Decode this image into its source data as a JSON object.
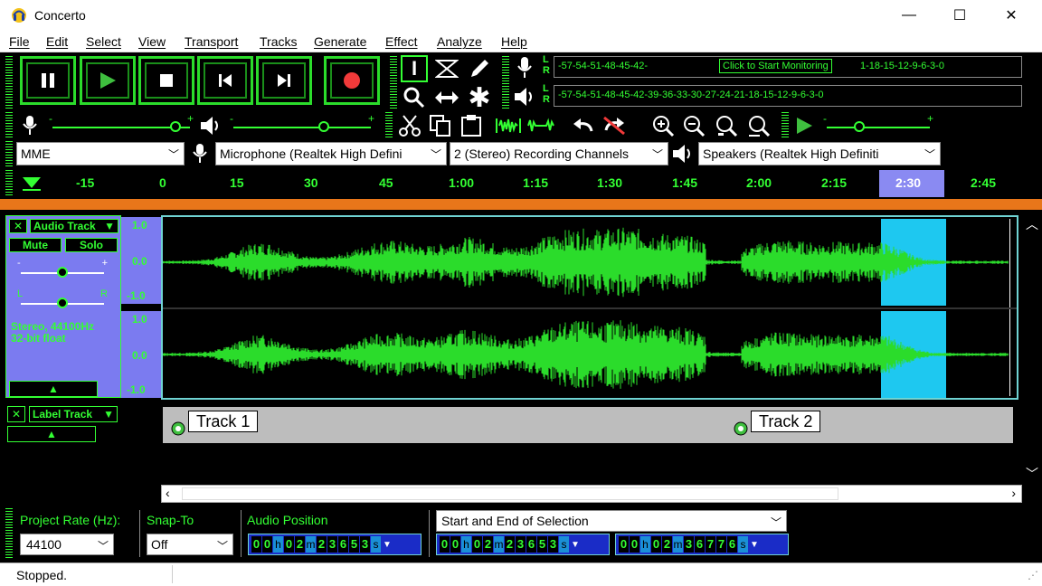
{
  "window": {
    "title": "Concerto",
    "minimize": "—",
    "maximize": "☐",
    "close": "✕"
  },
  "menu": [
    "File",
    "Edit",
    "Select",
    "View",
    "Transport",
    "Tracks",
    "Generate",
    "Effect",
    "Analyze",
    "Help"
  ],
  "meters": {
    "record_scale": "-57-54-51-48-45-42-",
    "monitor_prompt": "Click to Start Monitoring",
    "record_scale_right": "1-18-15-12-9-6-3-0",
    "play_scale": "-57-54-51-48-45-42-39-36-33-30-27-24-21-18-15-12-9-6-3-0",
    "channel_l": "L",
    "channel_r": "R"
  },
  "mixer": {
    "minus": "-",
    "plus": "+"
  },
  "device": {
    "host": "MME",
    "input": "Microphone (Realtek High Defini",
    "channels": "2 (Stereo) Recording Channels",
    "output": "Speakers (Realtek High Definiti"
  },
  "timeline": {
    "ticks": [
      "-15",
      "0",
      "15",
      "30",
      "45",
      "1:00",
      "1:15",
      "1:30",
      "1:45",
      "2:00",
      "2:15",
      "2:30",
      "2:45"
    ]
  },
  "audio_track": {
    "name": "Audio Track",
    "mute": "Mute",
    "solo": "Solo",
    "info_line1": "Stereo, 44100Hz",
    "info_line2": "32-bit float",
    "pan_l": "L",
    "pan_r": "R",
    "ruler_top": [
      "1.0",
      "0.0",
      "-1.0"
    ],
    "ruler_bottom": [
      "1.0",
      "0.0",
      "-1.0"
    ]
  },
  "label_track": {
    "name": "Label Track",
    "labels": [
      "Track 1",
      "Track 2"
    ]
  },
  "selection_toolbar": {
    "project_rate_label": "Project Rate (Hz):",
    "project_rate": "44100",
    "snap_to_label": "Snap-To",
    "snap_to": "Off",
    "audio_position_label": "Audio Position",
    "selection_mode": "Start and End of Selection",
    "audio_position": [
      "0",
      "0",
      "h",
      "0",
      "2",
      "m",
      "2",
      "3",
      "6",
      "5",
      "3",
      "s"
    ],
    "sel_start": [
      "0",
      "0",
      "h",
      "0",
      "2",
      "m",
      "2",
      "3",
      "6",
      "5",
      "3",
      "s"
    ],
    "sel_end": [
      "0",
      "0",
      "h",
      "0",
      "2",
      "m",
      "3",
      "6",
      "7",
      "7",
      "6",
      "s"
    ]
  },
  "status": {
    "text": "Stopped."
  },
  "colors": {
    "accent": "#2bdc2b",
    "track_panel": "#7b7bf0",
    "selection": "#1ec8f0",
    "timeline_bar": "#e8761a"
  }
}
